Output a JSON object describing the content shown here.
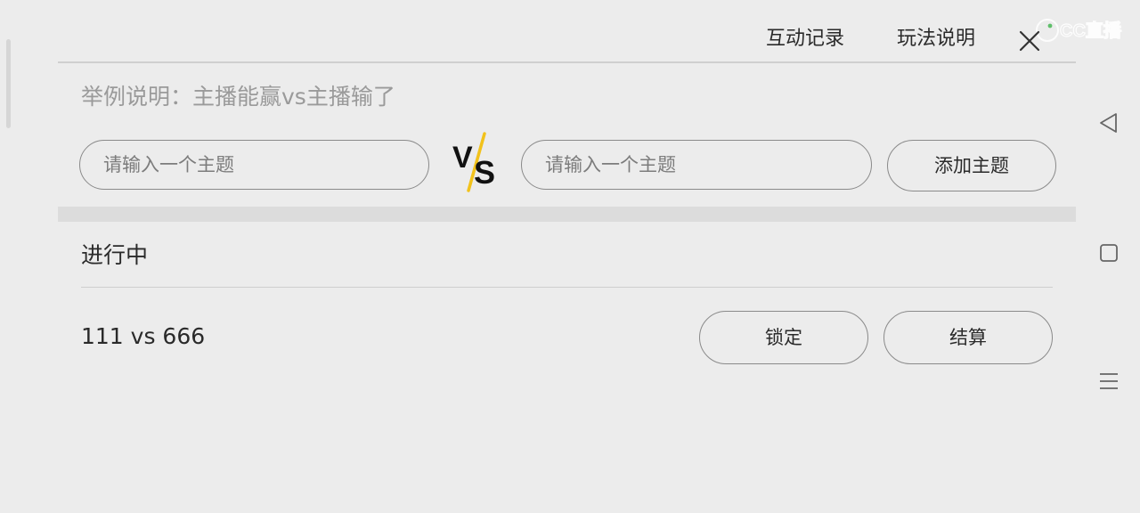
{
  "watermark": {
    "text": "CC直播"
  },
  "header": {
    "records_label": "互动记录",
    "rules_label": "玩法说明"
  },
  "hint": {
    "text": "举例说明：主播能赢vs主播输了"
  },
  "topic_form": {
    "left_placeholder": "请输入一个主题",
    "right_placeholder": "请输入一个主题",
    "vs_label": "VS",
    "add_label": "添加主题"
  },
  "in_progress": {
    "title": "进行中",
    "matches": [
      {
        "name": "111 vs 666",
        "lock_label": "锁定",
        "settle_label": "结算"
      }
    ]
  },
  "colors": {
    "background": "#ececec",
    "vs_accent": "#f2c21b",
    "text": "#2a2a2a",
    "hint": "#9a9a9a"
  },
  "icons": {
    "close": "close-icon",
    "back": "back-triangle-icon",
    "home": "home-square-icon",
    "menu": "menu-lines-icon"
  }
}
